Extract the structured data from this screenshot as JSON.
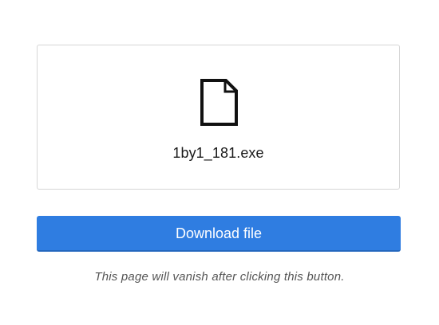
{
  "file": {
    "icon": "file-icon",
    "name": "1by1_181.exe"
  },
  "download": {
    "label": "Download file",
    "color": "#2f7de1"
  },
  "note": "This page will vanish after clicking this button."
}
